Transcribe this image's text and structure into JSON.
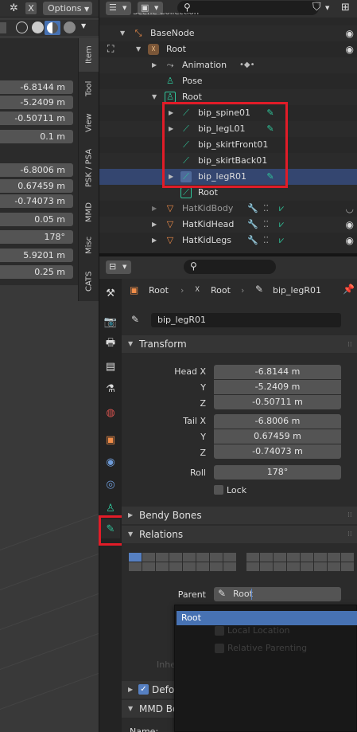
{
  "viewport": {
    "header": {
      "menu_x": "X",
      "options": "Options"
    },
    "tabs": [
      "Item",
      "Tool",
      "View",
      "PSK / PSA",
      "MMD",
      "Misc",
      "CATS"
    ],
    "fields": [
      "-6.8144 m",
      "-5.2409 m",
      "-0.50711 m",
      "0.1 m",
      "-6.8006 m",
      "0.67459 m",
      "-0.74073 m",
      "0.05 m",
      "178°",
      "5.9201 m",
      "0.25 m"
    ]
  },
  "outliner": {
    "header_partial": "Scene Collection",
    "rows": [
      {
        "label": "BaseNode",
        "indent": 1
      },
      {
        "label": "Root",
        "indent": 2
      },
      {
        "label": "Animation",
        "indent": 3
      },
      {
        "label": "Pose",
        "indent": 3
      },
      {
        "label": "Root",
        "indent": 3
      },
      {
        "label": "bip_spine01",
        "indent": 4
      },
      {
        "label": "bip_legL01",
        "indent": 4
      },
      {
        "label": "bip_skirtFront01",
        "indent": 4
      },
      {
        "label": "bip_skirtBack01",
        "indent": 4
      },
      {
        "label": "bip_legR01",
        "indent": 4
      },
      {
        "label": "Root",
        "indent": 4
      },
      {
        "label": "HatKidBody",
        "indent": 2
      },
      {
        "label": "HatKidHead",
        "indent": 2
      },
      {
        "label": "HatKidLegs",
        "indent": 2
      }
    ]
  },
  "properties": {
    "breadcrumb": [
      "Root",
      "Root",
      "bip_legR01"
    ],
    "bone_name": "bip_legR01",
    "panels": {
      "transform": "Transform",
      "bendy": "Bendy Bones",
      "relations": "Relations",
      "deform": "Deform",
      "mmd": "MMD Bone Tools"
    },
    "transform": {
      "head_label": "Head X",
      "y_label": "Y",
      "z_label": "Z",
      "tail_label": "Tail X",
      "roll_label": "Roll",
      "lock_label": "Lock",
      "head": [
        "-6.8144 m",
        "-5.2409 m",
        "-0.50711 m"
      ],
      "tail": [
        "-6.8006 m",
        "0.67459 m",
        "-0.74073 m"
      ],
      "roll": "178°"
    },
    "relations": {
      "parent_label": "Parent",
      "parent_value": "Root"
    },
    "dropdown": {
      "selected": "Root",
      "ghost_items": [
        "Local Location",
        "Relative Parenting",
        "Inherit Scale"
      ]
    },
    "partial_label": "Name:"
  },
  "colors": {
    "selection": "#344670",
    "highlight_red": "#e11c28",
    "bone_green": "#2fc59a",
    "accent_blue": "#4772b3"
  }
}
